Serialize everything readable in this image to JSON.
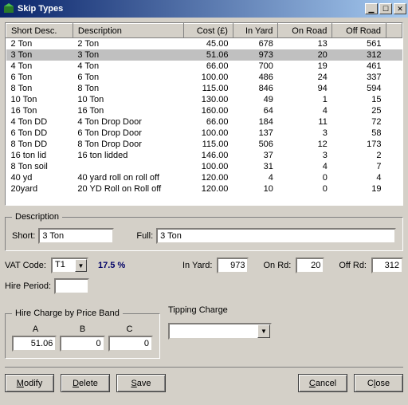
{
  "window": {
    "title": "Skip Types"
  },
  "table": {
    "headers": [
      "Short Desc.",
      "Description",
      "Cost (£)",
      "In Yard",
      "On Road",
      "Off Road"
    ],
    "rows": [
      {
        "short": "2 Ton",
        "desc": "2 Ton",
        "cost": "45.00",
        "inYard": "678",
        "onRoad": "13",
        "offRoad": "561",
        "selected": false
      },
      {
        "short": "3 Ton",
        "desc": "3 Ton",
        "cost": "51.06",
        "inYard": "973",
        "onRoad": "20",
        "offRoad": "312",
        "selected": true
      },
      {
        "short": "4 Ton",
        "desc": "4 Ton",
        "cost": "66.00",
        "inYard": "700",
        "onRoad": "19",
        "offRoad": "461",
        "selected": false
      },
      {
        "short": "6 Ton",
        "desc": "6 Ton",
        "cost": "100.00",
        "inYard": "486",
        "onRoad": "24",
        "offRoad": "337",
        "selected": false
      },
      {
        "short": "8 Ton",
        "desc": "8 Ton",
        "cost": "115.00",
        "inYard": "846",
        "onRoad": "94",
        "offRoad": "594",
        "selected": false
      },
      {
        "short": "10 Ton",
        "desc": "10 Ton",
        "cost": "130.00",
        "inYard": "49",
        "onRoad": "1",
        "offRoad": "15",
        "selected": false
      },
      {
        "short": "16 Ton",
        "desc": "16 Ton",
        "cost": "160.00",
        "inYard": "64",
        "onRoad": "4",
        "offRoad": "25",
        "selected": false
      },
      {
        "short": "4 Ton DD",
        "desc": "4 Ton Drop Door",
        "cost": "66.00",
        "inYard": "184",
        "onRoad": "11",
        "offRoad": "72",
        "selected": false
      },
      {
        "short": "6 Ton DD",
        "desc": "6 Ton Drop Door",
        "cost": "100.00",
        "inYard": "137",
        "onRoad": "3",
        "offRoad": "58",
        "selected": false
      },
      {
        "short": "8 Ton DD",
        "desc": "8 Ton Drop Door",
        "cost": "115.00",
        "inYard": "506",
        "onRoad": "12",
        "offRoad": "173",
        "selected": false
      },
      {
        "short": "16 ton lid",
        "desc": "16 ton lidded",
        "cost": "146.00",
        "inYard": "37",
        "onRoad": "3",
        "offRoad": "2",
        "selected": false
      },
      {
        "short": "8 Ton soil",
        "desc": "",
        "cost": "100.00",
        "inYard": "31",
        "onRoad": "4",
        "offRoad": "7",
        "selected": false
      },
      {
        "short": "40 yd",
        "desc": "40 yard roll on roll off",
        "cost": "120.00",
        "inYard": "4",
        "onRoad": "0",
        "offRoad": "4",
        "selected": false
      },
      {
        "short": "20yard",
        "desc": "20 YD Roll on Roll off",
        "cost": "120.00",
        "inYard": "10",
        "onRoad": "0",
        "offRoad": "19",
        "selected": false
      }
    ]
  },
  "description": {
    "legend": "Description",
    "shortLabel": "Short:",
    "shortValue": "3 Ton",
    "fullLabel": "Full:",
    "fullValue": "3 Ton"
  },
  "vat": {
    "label": "VAT Code:",
    "value": "T1",
    "percent": "17.5 %"
  },
  "yard": {
    "inLabel": "In Yard:",
    "inValue": "973",
    "onLabel": "On Rd:",
    "onValue": "20",
    "offLabel": "Off Rd:",
    "offValue": "312"
  },
  "hirePeriod": {
    "label": "Hire Period:",
    "value": ""
  },
  "priceBand": {
    "legend": "Hire Charge by Price Band",
    "cols": [
      "A",
      "B",
      "C"
    ],
    "values": [
      "51.06",
      "0",
      "0"
    ]
  },
  "tipping": {
    "legend": "Tipping Charge",
    "value": ""
  },
  "buttons": {
    "modify": "Modify",
    "delete": "Delete",
    "save": "Save",
    "cancel": "Cancel",
    "close": "Close"
  }
}
